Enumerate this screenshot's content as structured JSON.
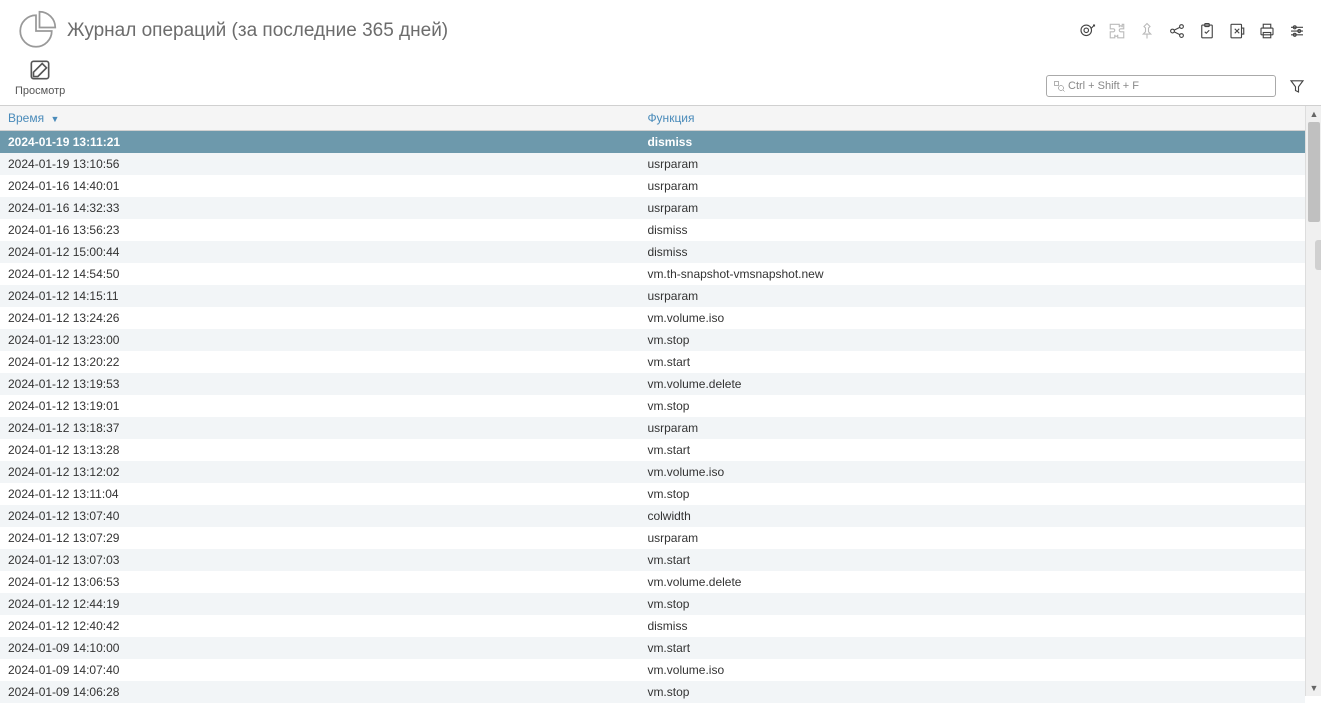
{
  "header": {
    "title": "Журнал операций (за последние 365 дней)"
  },
  "toolbar": {
    "view_label": "Просмотр"
  },
  "search": {
    "placeholder": "Ctrl + Shift + F"
  },
  "table": {
    "columns": {
      "time": "Время",
      "func": "Функция"
    },
    "rows": [
      {
        "time": "2024-01-19 13:11:21",
        "func": "dismiss",
        "selected": true
      },
      {
        "time": "2024-01-19 13:10:56",
        "func": "usrparam"
      },
      {
        "time": "2024-01-16 14:40:01",
        "func": "usrparam"
      },
      {
        "time": "2024-01-16 14:32:33",
        "func": "usrparam"
      },
      {
        "time": "2024-01-16 13:56:23",
        "func": "dismiss"
      },
      {
        "time": "2024-01-12 15:00:44",
        "func": "dismiss"
      },
      {
        "time": "2024-01-12 14:54:50",
        "func": "vm.th-snapshot-vmsnapshot.new"
      },
      {
        "time": "2024-01-12 14:15:11",
        "func": "usrparam"
      },
      {
        "time": "2024-01-12 13:24:26",
        "func": "vm.volume.iso"
      },
      {
        "time": "2024-01-12 13:23:00",
        "func": "vm.stop"
      },
      {
        "time": "2024-01-12 13:20:22",
        "func": "vm.start"
      },
      {
        "time": "2024-01-12 13:19:53",
        "func": "vm.volume.delete"
      },
      {
        "time": "2024-01-12 13:19:01",
        "func": "vm.stop"
      },
      {
        "time": "2024-01-12 13:18:37",
        "func": "usrparam"
      },
      {
        "time": "2024-01-12 13:13:28",
        "func": "vm.start"
      },
      {
        "time": "2024-01-12 13:12:02",
        "func": "vm.volume.iso"
      },
      {
        "time": "2024-01-12 13:11:04",
        "func": "vm.stop"
      },
      {
        "time": "2024-01-12 13:07:40",
        "func": "colwidth"
      },
      {
        "time": "2024-01-12 13:07:29",
        "func": "usrparam"
      },
      {
        "time": "2024-01-12 13:07:03",
        "func": "vm.start"
      },
      {
        "time": "2024-01-12 13:06:53",
        "func": "vm.volume.delete"
      },
      {
        "time": "2024-01-12 12:44:19",
        "func": "vm.stop"
      },
      {
        "time": "2024-01-12 12:40:42",
        "func": "dismiss"
      },
      {
        "time": "2024-01-09 14:10:00",
        "func": "vm.start"
      },
      {
        "time": "2024-01-09 14:07:40",
        "func": "vm.volume.iso"
      },
      {
        "time": "2024-01-09 14:06:28",
        "func": "vm.stop"
      }
    ]
  }
}
